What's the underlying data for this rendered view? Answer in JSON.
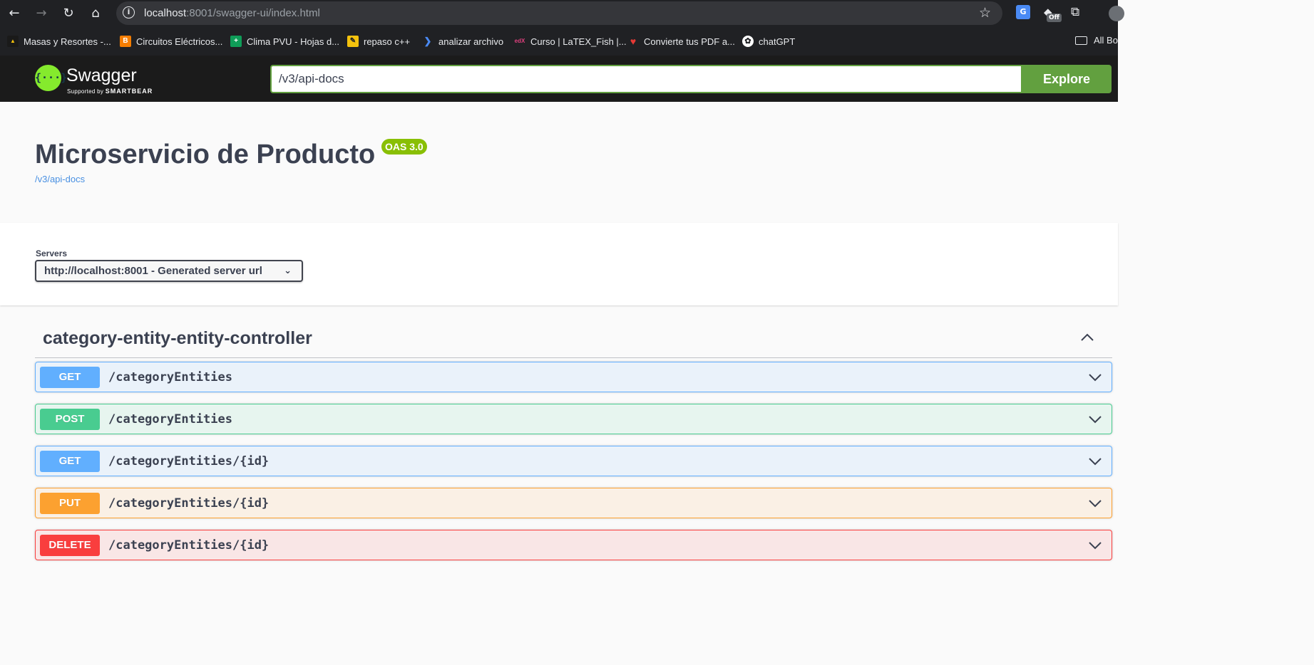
{
  "browser": {
    "url_host": "localhost",
    "url_rest": ":8001/swagger-ui/index.html",
    "extension_badge": "Off",
    "bookmarks": [
      {
        "label": "Masas y Resortes  -...",
        "icon": "phet-icon",
        "color": "#1a1a1a"
      },
      {
        "label": "Circuitos Eléctricos...",
        "icon": "blogger-icon",
        "color": "#f57d00"
      },
      {
        "label": "Clima PVU - Hojas d...",
        "icon": "sheets-icon",
        "color": "#0f9d58"
      },
      {
        "label": "repaso c++",
        "icon": "pencil-icon",
        "color": "#f4c20d"
      },
      {
        "label": "analizar archivo",
        "icon": "powershell-icon",
        "color": "#1f5fbf"
      },
      {
        "label": "Curso | LaTEX_Fish |...",
        "icon": "edx-icon",
        "color": "#2c3e50"
      },
      {
        "label": "Convierte tus PDF a...",
        "icon": "heart-icon",
        "color": "#e53935"
      },
      {
        "label": "chatGPT",
        "icon": "openai-icon",
        "color": "#ffffff"
      }
    ],
    "all_bookmarks": "All Bo"
  },
  "topbar": {
    "logo_text": "Swagger",
    "logo_sub_prefix": "Supported by",
    "logo_sub_brand": "SMARTBEAR",
    "spec_url": "/v3/api-docs",
    "explore_label": "Explore"
  },
  "info": {
    "title": "Microservicio de Producto",
    "version_badge": "OAS 3.0",
    "spec_link": "/v3/api-docs"
  },
  "servers": {
    "label": "Servers",
    "selected": "http://localhost:8001 - Generated server url"
  },
  "tag": {
    "name": "category-entity-entity-controller",
    "operations": [
      {
        "method": "GET",
        "path": "/categoryEntities"
      },
      {
        "method": "POST",
        "path": "/categoryEntities"
      },
      {
        "method": "GET",
        "path": "/categoryEntities/{id}"
      },
      {
        "method": "PUT",
        "path": "/categoryEntities/{id}"
      },
      {
        "method": "DELETE",
        "path": "/categoryEntities/{id}"
      }
    ]
  }
}
